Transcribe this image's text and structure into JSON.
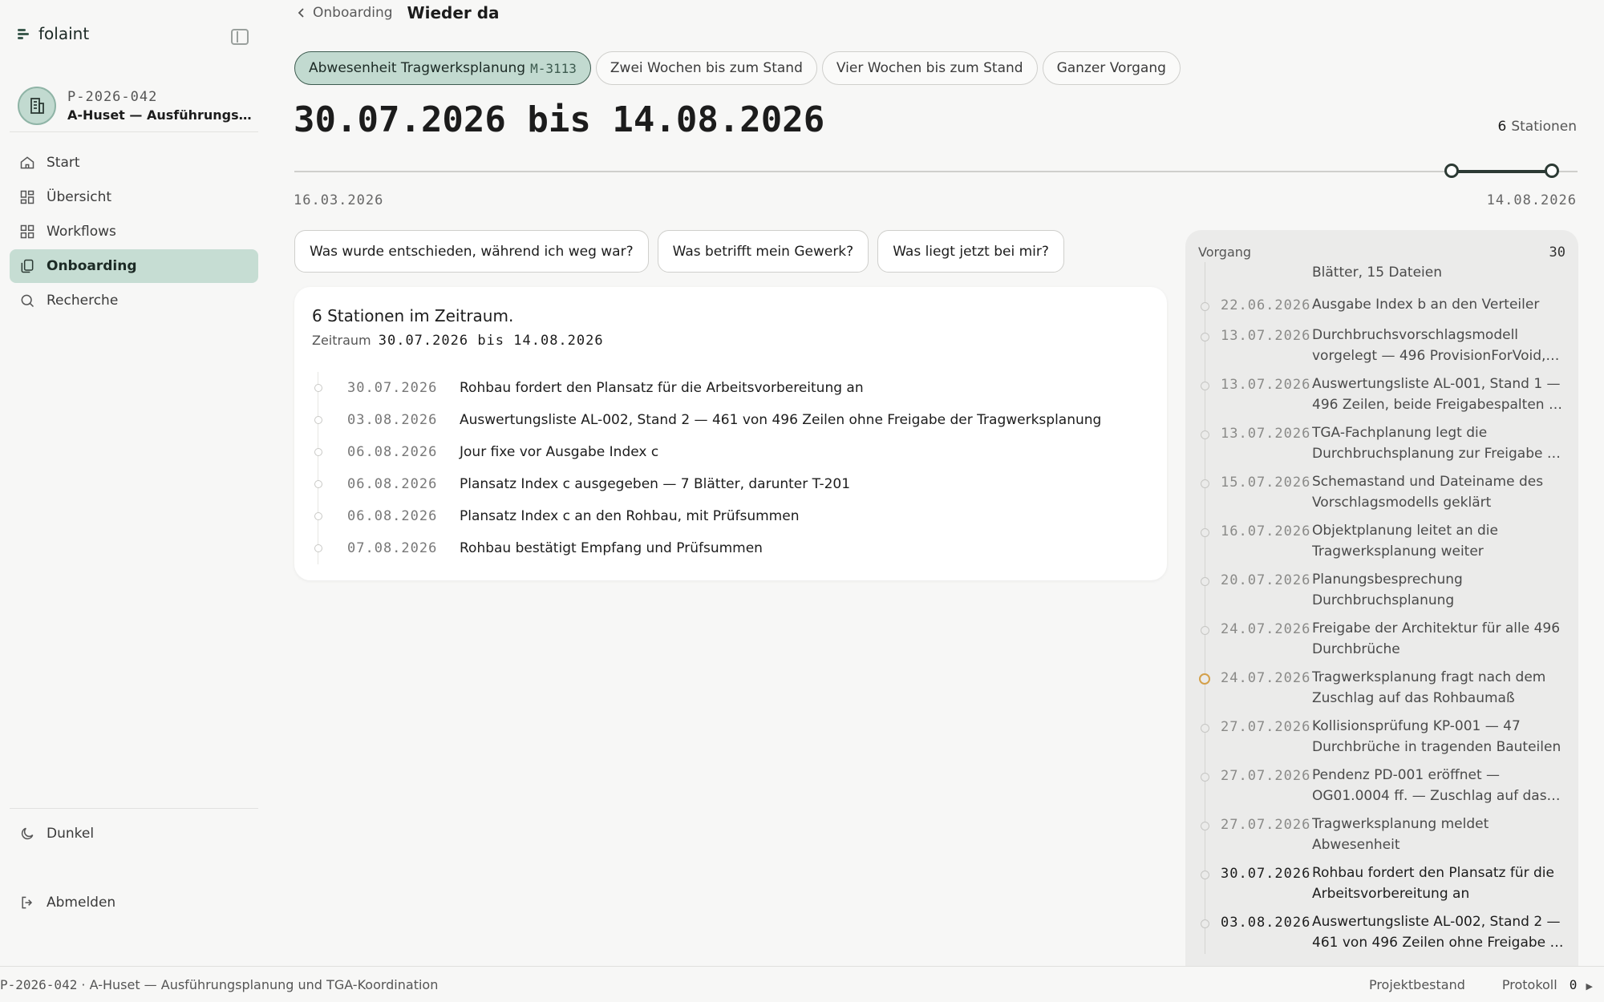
{
  "app": {
    "name": "folaint"
  },
  "project": {
    "code": "P-2026-042",
    "name": "A-Huset — Ausführungsplanung und TGA-Koordination",
    "name_short": "A-Huset — Ausführungsplan…"
  },
  "nav": [
    {
      "label": "Start",
      "icon": "home-icon"
    },
    {
      "label": "Übersicht",
      "icon": "grid-icon"
    },
    {
      "label": "Workflows",
      "icon": "workflows-icon"
    },
    {
      "label": "Onboarding",
      "icon": "onboarding-icon",
      "active": true
    },
    {
      "label": "Recherche",
      "icon": "search-icon"
    }
  ],
  "sidebar_bottom": {
    "theme_label": "Dunkel",
    "logout_label": "Abmelden"
  },
  "header": {
    "back_label": "Onboarding",
    "title": "Wieder da"
  },
  "chips": {
    "absence_label": "Abwesenheit Tragwerksplanung",
    "absence_ref": "M-3113",
    "two_weeks": "Zwei Wochen bis zum Stand",
    "four_weeks": "Vier Wochen bis zum Stand",
    "whole": "Ganzer Vorgang"
  },
  "range": {
    "title": "30.07.2026 bis 14.08.2026",
    "count": "6",
    "count_label": "Stationen"
  },
  "slider": {
    "start": "16.03.2026",
    "end": "14.08.2026",
    "range_start_fraction": 0.92,
    "range_end_fraction": 1.0
  },
  "questions": [
    "Was wurde entschieden, während ich weg war?",
    "Was betrifft mein Gewerk?",
    "Was liegt jetzt bei mir?"
  ],
  "result": {
    "title": "6 Stationen im Zeitraum.",
    "sub_label": "Zeitraum",
    "sub_value": "30.07.2026 bis 14.08.2026",
    "entries": [
      {
        "date": "30.07.2026",
        "text": "Rohbau fordert den Plansatz für die Arbeitsvorbereitung an"
      },
      {
        "date": "03.08.2026",
        "text": "Auswertungsliste AL-002, Stand 2 — 461 von 496 Zeilen ohne Freigabe der Tragwerksplanung"
      },
      {
        "date": "06.08.2026",
        "text": "Jour fixe vor Ausgabe Index c"
      },
      {
        "date": "06.08.2026",
        "text": "Plansatz Index c ausgegeben — 7 Blätter, darunter T-201"
      },
      {
        "date": "06.08.2026",
        "text": "Plansatz Index c an den Rohbau, mit Prüfsummen"
      },
      {
        "date": "07.08.2026",
        "text": "Rohbau bestätigt Empfang und Prüfsummen"
      }
    ]
  },
  "panel": {
    "title": "Vorgang",
    "count": "30",
    "entries": [
      {
        "date": "",
        "l1": "Blätter, 15 Dateien",
        "l2": ""
      },
      {
        "date": "22.06.2026",
        "l1": "Ausgabe Index b an den Verteiler",
        "l2": ""
      },
      {
        "date": "13.07.2026",
        "l1": "Durchbruchsvorschlagsmodell",
        "l2": "vorgelegt — 496 ProvisionForVoid,…"
      },
      {
        "date": "13.07.2026",
        "l1": "Auswertungsliste AL-001, Stand 1 —",
        "l2": "496 Zeilen, beide Freigabespalten leer"
      },
      {
        "date": "13.07.2026",
        "l1": "TGA-Fachplanung legt die",
        "l2": "Durchbruchsplanung zur Freigabe vor"
      },
      {
        "date": "15.07.2026",
        "l1": "Schemastand und Dateiname des",
        "l2": "Vorschlagsmodells geklärt"
      },
      {
        "date": "16.07.2026",
        "l1": "Objektplanung leitet an die",
        "l2": "Tragwerksplanung weiter"
      },
      {
        "date": "20.07.2026",
        "l1": "Planungsbesprechung",
        "l2": "Durchbruchsplanung"
      },
      {
        "date": "24.07.2026",
        "l1": "Freigabe der Architektur für alle 496",
        "l2": "Durchbrüche"
      },
      {
        "date": "24.07.2026",
        "l1": "Tragwerksplanung fragt nach dem",
        "l2": "Zuschlag auf das Rohbaumaß",
        "highlight": true
      },
      {
        "date": "27.07.2026",
        "l1": "Kollisionsprüfung KP-001 — 47",
        "l2": "Durchbrüche in tragenden Bauteilen"
      },
      {
        "date": "27.07.2026",
        "l1": "Pendenz PD-001 eröffnet —",
        "l2": "OG01.0004 ff. — Zuschlag auf das…"
      },
      {
        "date": "27.07.2026",
        "l1": "Tragwerksplanung meldet",
        "l2": "Abwesenheit"
      },
      {
        "date": "30.07.2026",
        "l1": "Rohbau fordert den Plansatz für die",
        "l2": "Arbeitsvorbereitung an",
        "dark": true
      },
      {
        "date": "03.08.2026",
        "l1": "Auswertungsliste AL-002, Stand 2 —",
        "l2": "461 von 496 Zeilen ohne Freigabe der…",
        "dark": true
      }
    ]
  },
  "statusbar": {
    "left": "P-2026-042 · A-Huset — Ausführungsplanung und TGA-Koordination",
    "projekt": "Projektbestand",
    "protokoll": "Protokoll",
    "protokoll_count": "0"
  }
}
